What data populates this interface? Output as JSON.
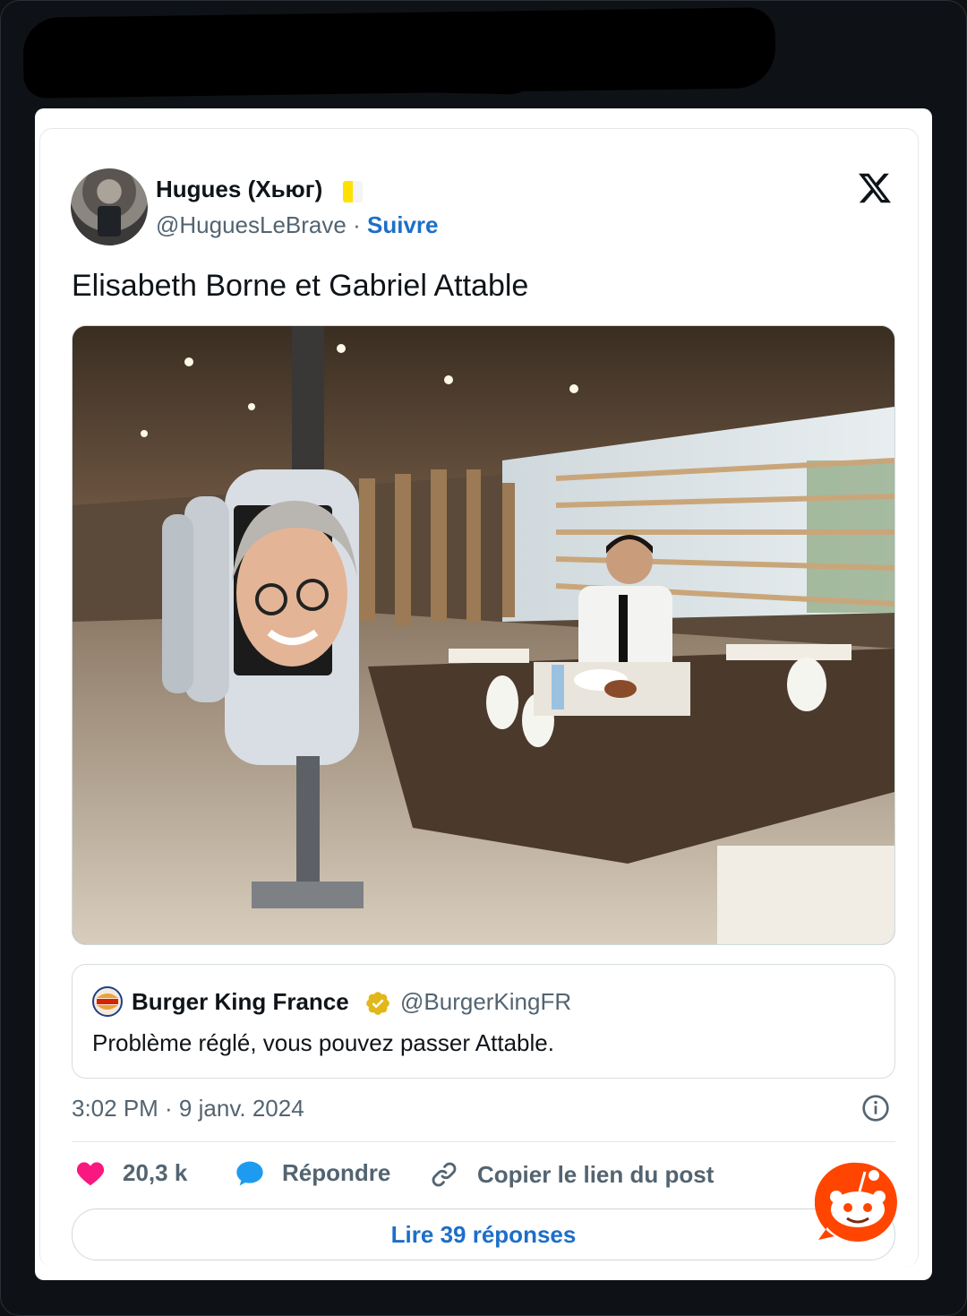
{
  "tweet": {
    "author_name": "Hugues (Хьюг)",
    "handle": "@HuguesLeBrave",
    "separator": "·",
    "follow_label": "Suivre",
    "text": "Elisabeth Borne et Gabriel Attable",
    "timestamp": "3:02 PM · 9 janv. 2024"
  },
  "quoted": {
    "author_name": "Burger King France",
    "handle": "@BurgerKingFR",
    "text": "Problème réglé, vous pouvez passer Attable."
  },
  "actions": {
    "likes": "20,3 k",
    "reply_label": "Répondre",
    "copy_link_label": "Copier le lien du post",
    "read_replies_label": "Lire 39 réponses"
  },
  "colors": {
    "accent": "#1d6fc9",
    "like": "#f91880",
    "reply": "#1d9bf0",
    "verified": "#e2b719"
  },
  "icons": [
    "x-logo-icon",
    "verified-badge-icon",
    "info-icon",
    "heart-icon",
    "reply-bubble-icon",
    "link-icon",
    "reddit-snoo-icon"
  ]
}
